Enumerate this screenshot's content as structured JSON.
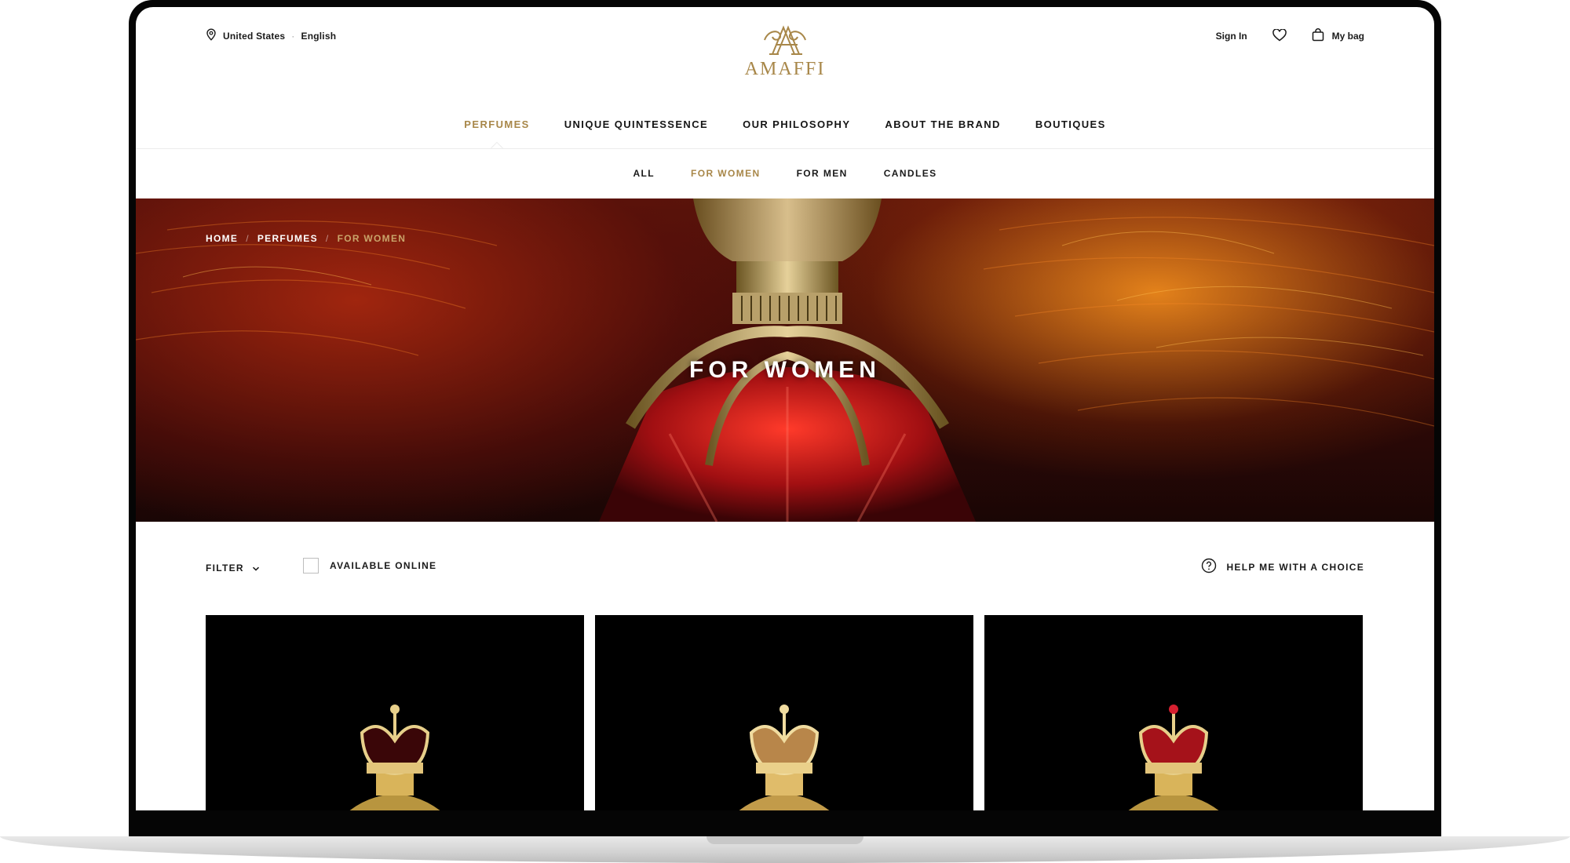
{
  "header": {
    "country": "United States",
    "separator": "·",
    "language": "English",
    "logo_text": "AMAFFI",
    "sign_in": "Sign In",
    "bag_label": "My bag"
  },
  "main_nav": [
    {
      "label": "PERFUMES",
      "active": true
    },
    {
      "label": "UNIQUE QUINTESSENCE",
      "active": false
    },
    {
      "label": "OUR PHILOSOPHY",
      "active": false
    },
    {
      "label": "ABOUT THE BRAND",
      "active": false
    },
    {
      "label": "BOUTIQUES",
      "active": false
    }
  ],
  "sub_nav": [
    {
      "label": "ALL",
      "active": false
    },
    {
      "label": "FOR WOMEN",
      "active": true
    },
    {
      "label": "FOR MEN",
      "active": false
    },
    {
      "label": "CANDLES",
      "active": false
    }
  ],
  "breadcrumb": [
    "HOME",
    "PERFUMES",
    "FOR WOMEN"
  ],
  "breadcrumb_separator": "/",
  "hero": {
    "title": "FOR WOMEN"
  },
  "toolbar": {
    "filter_label": "FILTER",
    "available_online_label": "AVAILABLE ONLINE",
    "available_online_checked": false,
    "help_label": "HELP ME WITH A CHOICE"
  },
  "products": [
    {
      "crown_color": "dark garnet"
    },
    {
      "crown_color": "champagne gold"
    },
    {
      "crown_color": "ruby red"
    }
  ],
  "colors": {
    "accent_gold": "#a88749",
    "text_dark": "#151515",
    "hero_red": "#5a150a",
    "hero_orange": "#ff9a1e"
  },
  "icons": [
    "location-pin-icon",
    "heart-icon",
    "shopping-bag-icon",
    "chevron-down-icon",
    "question-circle-icon"
  ]
}
